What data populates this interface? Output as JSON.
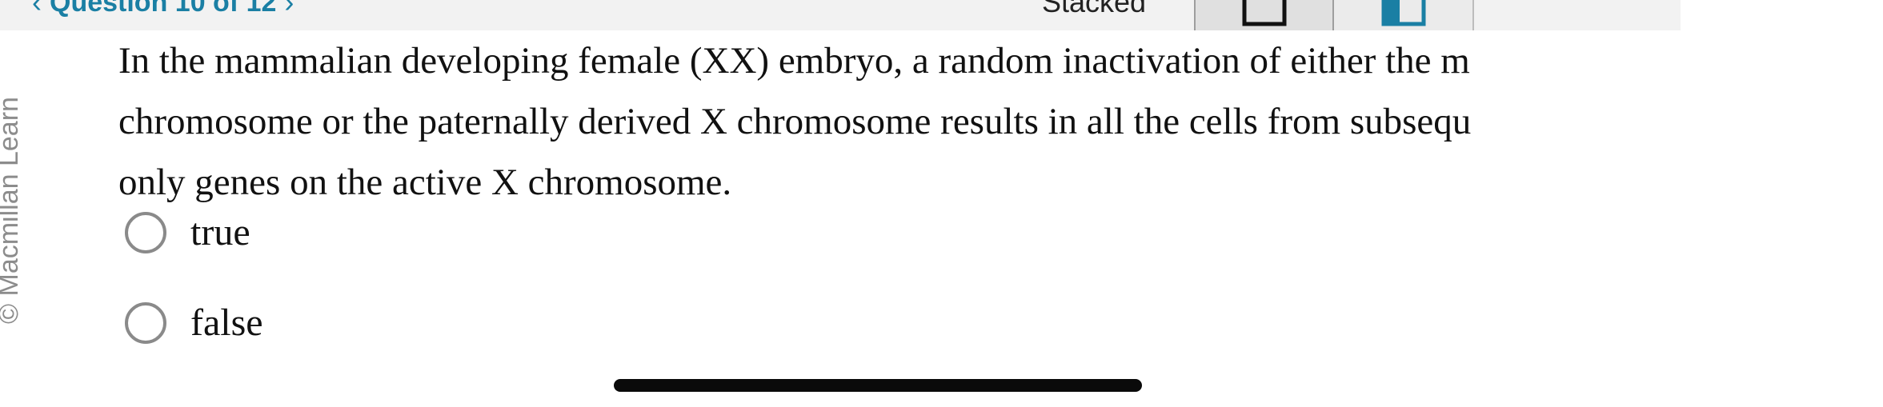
{
  "header": {
    "question_nav": "Question 10 of 12",
    "prev_chevron": "‹",
    "next_chevron": "›",
    "view_label": "Stacked",
    "view_toggle": [
      {
        "name": "stacked-view",
        "icon": "square-outline-icon",
        "selected": true
      },
      {
        "name": "split-view",
        "icon": "split-panel-icon",
        "selected": false
      }
    ],
    "accent_color": "#1a7fa4"
  },
  "side_credit": "© Macmillan Learn",
  "question": {
    "lines": [
      "In the mammalian developing female (XX) embryo, a random inactivation of either the m",
      "chromosome or the paternally derived X chromosome results in all the cells from subsequ",
      "only genes on the active X chromosome."
    ]
  },
  "options": [
    {
      "label": "true"
    },
    {
      "label": "false"
    }
  ]
}
